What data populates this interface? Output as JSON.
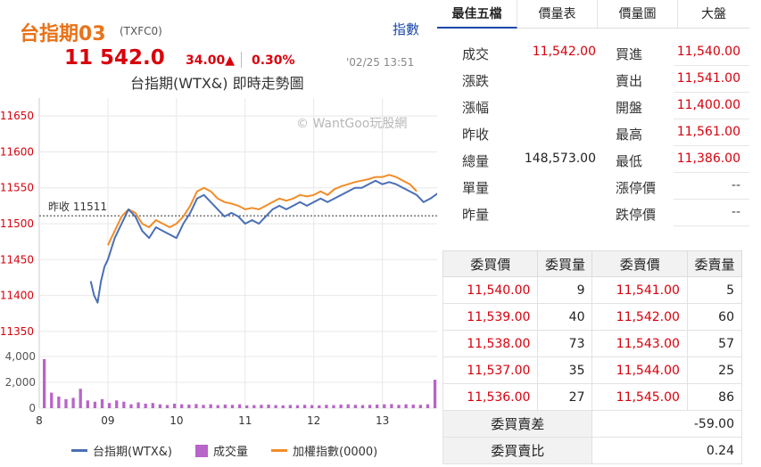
{
  "header": {
    "symbol_name": "台指期03",
    "symbol_code": "(TXFC0)",
    "index_link": "指數",
    "price": "11 542.0",
    "change": "34.00▲",
    "change_pct": "0.30%",
    "time": "'02/25 13:51",
    "chart_title": "台指期(WTX&) 即時走勢圖",
    "watermark": "© WantGoo玩股網"
  },
  "chart": {
    "prev_close_label": "昨收 11511",
    "price_ticks": [
      "11650",
      "11600",
      "11550",
      "11500",
      "11450",
      "11400",
      "11350"
    ],
    "volume_ticks": [
      "4,000",
      "2,000",
      "0"
    ],
    "time_ticks": [
      "8",
      "09",
      "10",
      "11",
      "12",
      "13"
    ],
    "colors": {
      "futures": "#4a6fb5",
      "volume": "#b864c8",
      "index": "#f28c28",
      "grid": "#e8e8e8",
      "prev_close": "#333333"
    }
  },
  "chart_data": {
    "type": "line",
    "y_range": [
      11325,
      11675
    ],
    "prev_close": 11511,
    "series": [
      {
        "name": "台指期(WTX&)",
        "x": [
          8.75,
          8.8,
          8.85,
          8.9,
          8.95,
          9.0,
          9.1,
          9.2,
          9.3,
          9.4,
          9.5,
          9.6,
          9.7,
          9.8,
          9.9,
          10.0,
          10.1,
          10.2,
          10.3,
          10.4,
          10.5,
          10.6,
          10.7,
          10.8,
          10.9,
          11.0,
          11.1,
          11.2,
          11.3,
          11.4,
          11.5,
          11.6,
          11.7,
          11.8,
          11.9,
          12.0,
          12.1,
          12.2,
          12.3,
          12.4,
          12.5,
          12.6,
          12.7,
          12.8,
          12.9,
          13.0,
          13.1,
          13.2,
          13.3,
          13.4,
          13.5,
          13.6,
          13.7,
          13.8
        ],
        "values": [
          11420,
          11400,
          11390,
          11420,
          11440,
          11450,
          11480,
          11500,
          11520,
          11510,
          11490,
          11480,
          11495,
          11490,
          11485,
          11480,
          11500,
          11515,
          11535,
          11540,
          11530,
          11520,
          11510,
          11515,
          11510,
          11500,
          11505,
          11500,
          11510,
          11520,
          11525,
          11520,
          11525,
          11530,
          11525,
          11530,
          11535,
          11530,
          11535,
          11540,
          11545,
          11550,
          11550,
          11555,
          11560,
          11555,
          11558,
          11555,
          11550,
          11545,
          11540,
          11530,
          11535,
          11542
        ]
      },
      {
        "name": "加權指數(0000)",
        "x": [
          9.0,
          9.1,
          9.2,
          9.3,
          9.4,
          9.5,
          9.6,
          9.7,
          9.8,
          9.9,
          10.0,
          10.1,
          10.2,
          10.3,
          10.4,
          10.5,
          10.6,
          10.7,
          10.8,
          10.9,
          11.0,
          11.1,
          11.2,
          11.3,
          11.4,
          11.5,
          11.6,
          11.7,
          11.8,
          11.9,
          12.0,
          12.1,
          12.2,
          12.3,
          12.4,
          12.5,
          12.6,
          12.7,
          12.8,
          12.9,
          13.0,
          13.1,
          13.2,
          13.3,
          13.4,
          13.5
        ],
        "values": [
          11470,
          11490,
          11510,
          11520,
          11515,
          11500,
          11495,
          11505,
          11500,
          11495,
          11500,
          11510,
          11525,
          11545,
          11550,
          11545,
          11535,
          11530,
          11528,
          11525,
          11520,
          11522,
          11520,
          11525,
          11530,
          11535,
          11532,
          11535,
          11540,
          11538,
          11540,
          11545,
          11540,
          11548,
          11552,
          11555,
          11558,
          11560,
          11562,
          11565,
          11565,
          11568,
          11565,
          11560,
          11555,
          11545
        ]
      }
    ],
    "volume": {
      "name": "成交量",
      "y_range": [
        0,
        4000
      ],
      "values": [
        3800,
        1200,
        900,
        700,
        800,
        1500,
        600,
        500,
        700,
        400,
        600,
        500,
        300,
        450,
        350,
        400,
        300,
        250,
        350,
        300,
        280,
        320,
        260,
        300,
        240,
        280,
        260,
        300,
        220,
        240,
        260,
        280,
        240,
        220,
        250,
        230,
        260,
        240,
        220,
        260,
        240,
        280,
        300,
        260,
        240,
        260,
        280,
        300,
        320,
        260,
        300,
        280,
        260,
        300,
        2200
      ]
    },
    "legend": [
      "台指期(WTX&)",
      "成交量",
      "加權指數(0000)"
    ]
  },
  "tabs": [
    "最佳五檔",
    "價量表",
    "價量圖",
    "大盤"
  ],
  "quote": {
    "rows": [
      {
        "l1": "成交",
        "v1": "11,542.00",
        "l2": "買進",
        "v2": "11,540.00"
      },
      {
        "l1": "漲跌",
        "v1": "",
        "l2": "賣出",
        "v2": "11,541.00"
      },
      {
        "l1": "漲幅",
        "v1": "",
        "l2": "開盤",
        "v2": "11,400.00"
      },
      {
        "l1": "昨收",
        "v1": "",
        "l2": "最高",
        "v2": "11,561.00"
      },
      {
        "l1": "總量",
        "v1": "148,573.00",
        "l2": "最低",
        "v2": "11,386.00"
      },
      {
        "l1": "單量",
        "v1": "",
        "l2": "漲停價",
        "v2": "--"
      },
      {
        "l1": "昨量",
        "v1": "",
        "l2": "跌停價",
        "v2": "--"
      }
    ]
  },
  "order_book": {
    "headers": [
      "委買價",
      "委買量",
      "委賣價",
      "委賣量"
    ],
    "rows": [
      [
        "11,540.00",
        "9",
        "11,541.00",
        "5"
      ],
      [
        "11,539.00",
        "40",
        "11,542.00",
        "60"
      ],
      [
        "11,538.00",
        "73",
        "11,543.00",
        "57"
      ],
      [
        "11,537.00",
        "35",
        "11,544.00",
        "25"
      ],
      [
        "11,536.00",
        "27",
        "11,545.00",
        "86"
      ]
    ],
    "diff_label": "委買賣差",
    "diff_value": "-59.00",
    "ratio_label": "委買賣比",
    "ratio_value": "0.24"
  }
}
